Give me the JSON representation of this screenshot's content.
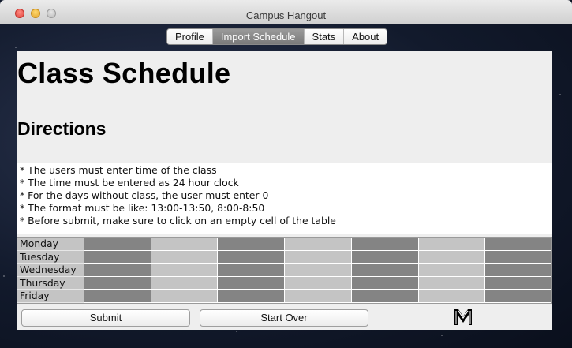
{
  "window": {
    "title": "Campus Hangout"
  },
  "tabs": [
    {
      "label": "Profile",
      "active": false
    },
    {
      "label": "Import Schedule",
      "active": true
    },
    {
      "label": "Stats",
      "active": false
    },
    {
      "label": "About",
      "active": false
    }
  ],
  "page": {
    "title": "Class Schedule",
    "subtitle": "Directions"
  },
  "directions": [
    "* The users must enter time of the class",
    "* The time must be entered as 24 hour clock",
    "* For the days without class, the user must enter 0",
    "* The format must be like: 13:00-13:50, 8:00-8:50",
    "* Before submit, make sure to click on an empty cell of the table"
  ],
  "schedule": {
    "days": [
      "Monday",
      "Tuesday",
      "Wednesday",
      "Thursday",
      "Friday"
    ]
  },
  "buttons": {
    "submit": "Submit",
    "start_over": "Start Over"
  },
  "colors": {
    "cell_dark": "#848484",
    "cell_light": "#c4c4c4",
    "active_tab": "#8a8a8a"
  }
}
